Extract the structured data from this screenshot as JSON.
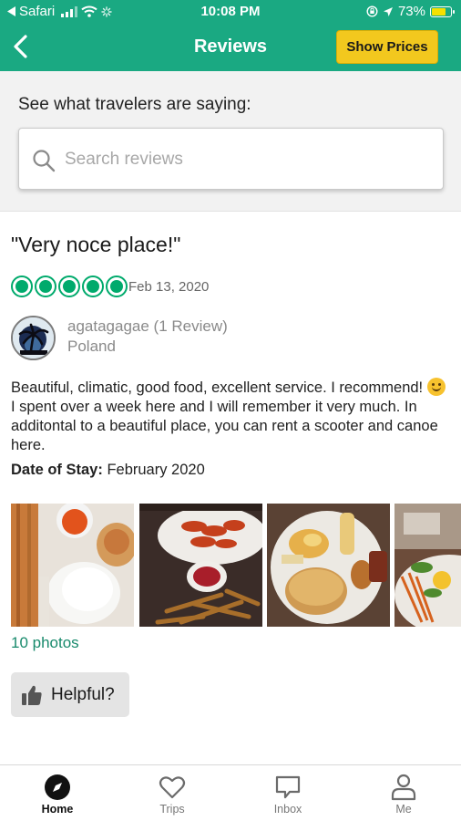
{
  "status_bar": {
    "carrier": "Safari",
    "time": "10:08 PM",
    "battery": "73%"
  },
  "header": {
    "title": "Reviews",
    "show_prices_label": "Show Prices"
  },
  "search": {
    "heading": "See what travelers are saying:",
    "placeholder": "Search reviews"
  },
  "review": {
    "title": "\"Very noce place!\"",
    "rating": 5,
    "rating_max": 5,
    "date": "Feb 13, 2020",
    "user": {
      "name": "agatagagae (1 Review)",
      "location": "Poland"
    },
    "body_part1": "Beautiful, climatic, good food, excellent service. I recommend!",
    "body_part2": "I spent over a week here and I will remember it very much. In additontal to a beautiful place, you can rent a scooter and canoe here.",
    "stay_label": "Date of Stay:",
    "stay_value": "February 2020",
    "photos_link": "10 photos",
    "photos": [
      {
        "name": "photo-spring-rolls-rice"
      },
      {
        "name": "photo-crayfish-fries"
      },
      {
        "name": "photo-pancakes"
      },
      {
        "name": "photo-salad"
      }
    ],
    "helpful_label": "Helpful?"
  },
  "tabs": [
    {
      "label": "Home",
      "icon": "compass-icon",
      "active": true
    },
    {
      "label": "Trips",
      "icon": "heart-icon",
      "active": false
    },
    {
      "label": "Inbox",
      "icon": "chat-icon",
      "active": false
    },
    {
      "label": "Me",
      "icon": "person-icon",
      "active": false
    }
  ],
  "colors": {
    "brand_green": "#1aa982",
    "rating_green": "#00aa6c",
    "show_prices_yellow": "#f2c81e",
    "link_green": "#188a6c",
    "battery_yellow": "#f5e000"
  }
}
